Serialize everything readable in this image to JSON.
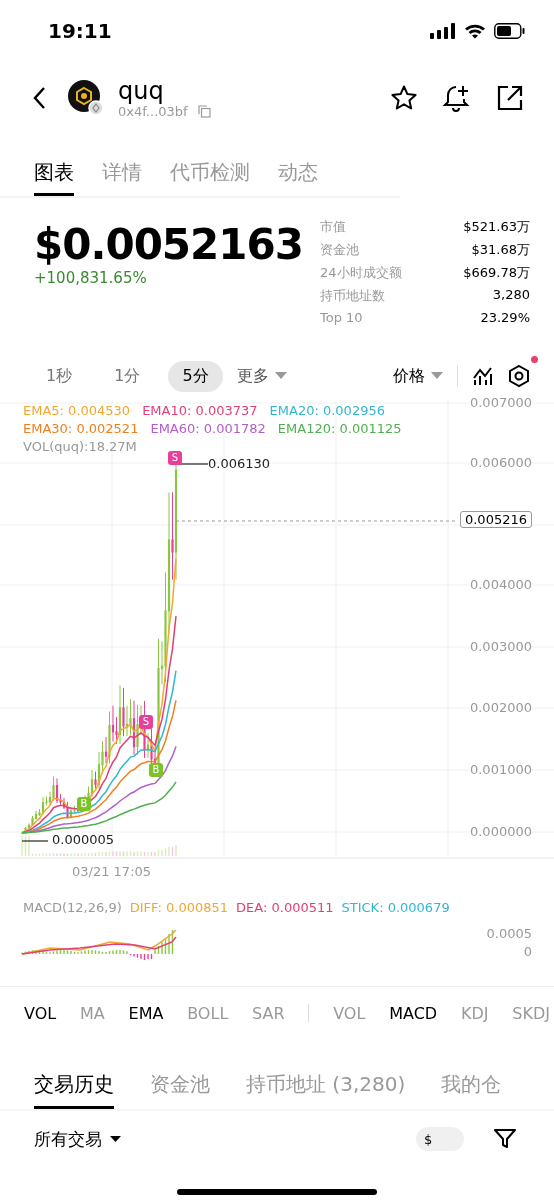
{
  "status_bar": {
    "time": "19:11"
  },
  "token": {
    "name": "quq",
    "address": "0x4f...03bf"
  },
  "tabs": [
    {
      "label": "图表",
      "selected": true
    },
    {
      "label": "详情",
      "selected": false
    },
    {
      "label": "代币检测",
      "selected": false
    },
    {
      "label": "动态",
      "selected": false
    }
  ],
  "price": {
    "value": "$0.0052163",
    "change": "+100,831.65%"
  },
  "stats": [
    {
      "label": "市值",
      "value": "$521.63万"
    },
    {
      "label": "资金池",
      "value": "$31.68万"
    },
    {
      "label": "24小时成交额",
      "value": "$669.78万"
    },
    {
      "label": "持币地址数",
      "value": "3,280"
    },
    {
      "label": "Top 10",
      "value": "23.29%"
    }
  ],
  "intervals": [
    {
      "label": "1秒",
      "selected": false
    },
    {
      "label": "1分",
      "selected": false
    },
    {
      "label": "5分",
      "selected": true
    }
  ],
  "more_dropdown": "更多",
  "price_dropdown": "价格",
  "settings_notification": true,
  "ema_legend": [
    {
      "text": "EMA5: 0.004530",
      "color": "#f0a830"
    },
    {
      "text": "EMA10: 0.003737",
      "color": "#e0407a"
    },
    {
      "text": "EMA20: 0.002956",
      "color": "#30b8d0"
    },
    {
      "text": "EMA30: 0.002521",
      "color": "#ee8020"
    },
    {
      "text": "EMA60: 0.001782",
      "color": "#b060c8"
    },
    {
      "text": "EMA120: 0.001125",
      "color": "#50b050"
    }
  ],
  "vol_label": "VOL(quq):18.27M",
  "y_ticks": [
    "0.007000",
    "0.006000",
    "0.004000",
    "0.003000",
    "0.002000",
    "0.001000",
    "0.000000"
  ],
  "high_marker": "0.006130",
  "low_marker": "0.000005",
  "current_price": "0.005216",
  "trade_marks": [
    {
      "letter": "S",
      "kind": "sell"
    },
    {
      "letter": "S",
      "kind": "sell"
    },
    {
      "letter": "B",
      "kind": "buy"
    },
    {
      "letter": "B",
      "kind": "buy"
    }
  ],
  "x_label": "03/21 17:05",
  "macd": {
    "title": "MACD(12,26,9)",
    "diff": "DIFF: 0.000851",
    "dea": "DEA: 0.000511",
    "stick": "STICK: 0.000679",
    "ticks": [
      "0.0005",
      "0"
    ]
  },
  "indicators_main": [
    {
      "label": "VOL",
      "selected": true
    },
    {
      "label": "MA",
      "selected": false
    },
    {
      "label": "EMA",
      "selected": true
    },
    {
      "label": "BOLL",
      "selected": false
    },
    {
      "label": "SAR",
      "selected": false
    }
  ],
  "indicators_sub": [
    {
      "label": "VOL",
      "selected": false
    },
    {
      "label": "MACD",
      "selected": true
    },
    {
      "label": "KDJ",
      "selected": false
    },
    {
      "label": "SKDJ",
      "selected": false
    }
  ],
  "bottom_tabs": [
    {
      "label": "交易历史",
      "selected": true
    },
    {
      "label": "资金池",
      "selected": false
    },
    {
      "label": "持币地址 (3,280)",
      "selected": false
    },
    {
      "label": "我的仓",
      "selected": false
    }
  ],
  "filter": {
    "label": "所有交易",
    "currency_toggle": "$"
  }
}
